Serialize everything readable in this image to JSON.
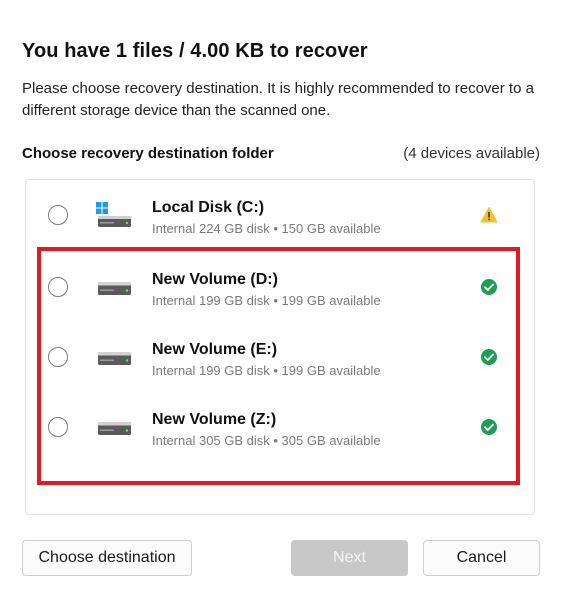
{
  "dialog": {
    "title": "You have 1 files / 4.00 KB to recover",
    "description": "Please choose recovery destination. It is highly recommended to recover to a different storage device than the scanned one."
  },
  "section": {
    "label": "Choose recovery destination folder",
    "count": "(4 devices available)"
  },
  "drives": [
    {
      "name": "Local Disk (C:)",
      "info": "Internal 224 GB disk • 150 GB available",
      "icon": "windows-drive-icon",
      "status": "warning"
    },
    {
      "name": "New Volume (D:)",
      "info": "Internal 199 GB disk • 199 GB available",
      "icon": "hard-drive-icon",
      "status": "ok"
    },
    {
      "name": "New Volume (E:)",
      "info": "Internal 199 GB disk • 199 GB available",
      "icon": "hard-drive-icon",
      "status": "ok"
    },
    {
      "name": "New Volume (Z:)",
      "info": "Internal 305 GB disk • 305 GB available",
      "icon": "hard-drive-icon",
      "status": "ok"
    }
  ],
  "buttons": {
    "choose": "Choose destination",
    "next": "Next",
    "cancel": "Cancel"
  },
  "colors": {
    "highlight": "#e01a22",
    "warning": "#f2c12e",
    "ok": "#1f9d55",
    "windows_blue": "#1a9be6"
  }
}
